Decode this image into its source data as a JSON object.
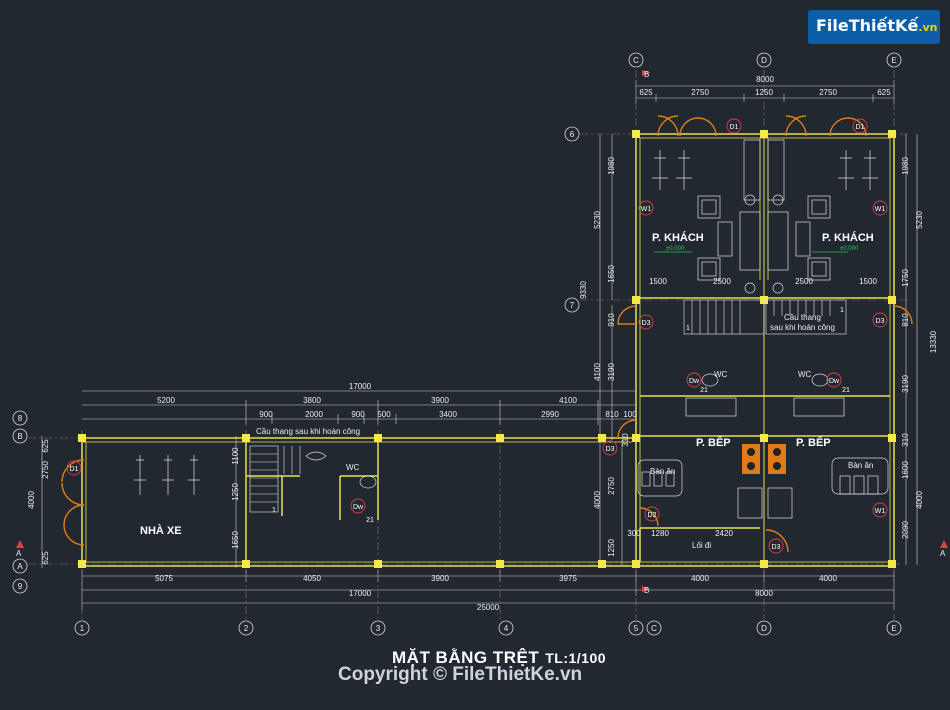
{
  "logo": {
    "text": "FileThiếtKế",
    "tld": ".vn"
  },
  "title": {
    "main": "MẶT BẰNG TRỆT",
    "scale": "TL:1/100"
  },
  "copyright": "Copyright © FileThietKe.vn",
  "grid_top": [
    "C",
    "D",
    "E"
  ],
  "grid_bottom": [
    "1",
    "2",
    "3",
    "4",
    "5",
    "C",
    "D",
    "E"
  ],
  "grid_left": [
    "6",
    "7",
    "8",
    "B",
    "A",
    "A",
    "9"
  ],
  "rooms": {
    "khach_left": "P. KHÁCH",
    "khach_right": "P. KHÁCH",
    "bep_left": "P. BẾP",
    "bep_right": "P. BẾP",
    "nha_xe": "NHÀ XE",
    "loi_di": "Lối đi",
    "wc1": "WC",
    "wc2": "WC",
    "wc3": "WC",
    "ban_an_left": "Bàn ăn",
    "ban_an_right": "Bàn ăn",
    "stair_left": "Cầu thang sau khi hoàn công",
    "stair_right_1": "Cầu thang",
    "stair_right_2": "sau khi hoàn công",
    "level_left": "±0.000",
    "level_right": "±0.000"
  },
  "tags": {
    "d1a": "D1",
    "d1b": "D1",
    "d1c": "D1",
    "w1a": "W1",
    "w1b": "W1",
    "w1c": "W1",
    "d3a": "D3",
    "d3b": "D3",
    "d3c": "D3",
    "d3d": "D3",
    "d2": "D2",
    "dwa": "Dw",
    "dwb": "Dw",
    "dwc": "Dw",
    "n21a": "21",
    "n21b": "21",
    "n21c": "21",
    "n1a": "1",
    "n1b": "1",
    "n1c": "1"
  },
  "dims": {
    "top_total": "8000",
    "top_a": "625",
    "top_b": "2750",
    "top_c": "1250",
    "top_d": "2750",
    "top_e": "625",
    "r1500a": "1500",
    "r2500a": "2500",
    "r2500b": "2500",
    "r1500b": "1500",
    "left_total": "17000",
    "l5200": "5200",
    "l3800": "3800",
    "l3900": "3900",
    "l4100": "4100",
    "l900a": "900",
    "l2000": "2000",
    "l900b": "900",
    "l500": "500",
    "l3400": "3400",
    "l2990": "2990",
    "l810": "810",
    "l100": "100",
    "b5075": "5075",
    "b4050": "4050",
    "b3900": "3900",
    "b3975": "3975",
    "b4000a": "4000",
    "b4000b": "4000",
    "b17000": "17000",
    "b8000": "8000",
    "b25000": "25000",
    "s300": "300",
    "s1280": "1280",
    "s2420": "2420",
    "v1980a": "1980",
    "v5230a": "5230",
    "v1650a": "1650",
    "v9330": "9330",
    "v910": "910",
    "v4100": "4100",
    "v3190a": "3190",
    "v2750": "2750",
    "v4000v": "4000",
    "v1250v": "1250",
    "v1980b": "1980",
    "v5230b": "5230",
    "v1750": "1750",
    "v810": "810",
    "v13330": "13330",
    "v3190b": "3190",
    "v310": "310",
    "v1600b": "1600",
    "v4000r": "4000",
    "v2090": "2090",
    "lv625a": "625",
    "lv2750": "2750",
    "lv4000": "4000",
    "lv625b": "625",
    "lv1100": "1100",
    "lv1250": "1250",
    "lv1650": "1650",
    "lv310": "310"
  },
  "markers": {
    "b_top": "B",
    "b_bottom": "B",
    "a_left": "A",
    "a_right": "A"
  }
}
